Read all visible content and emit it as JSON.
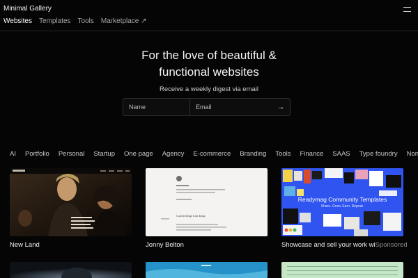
{
  "header": {
    "logo": "Minimal Gallery",
    "nav": [
      "Websites",
      "Templates",
      "Tools",
      "Marketplace ↗"
    ]
  },
  "hero": {
    "title_line1": "For the love of beautiful &",
    "title_line2": "functional websites",
    "subtitle": "Receive a weekly digest via email"
  },
  "form": {
    "name_placeholder": "Name",
    "email_placeholder": "Email",
    "submit": "→"
  },
  "filters": [
    "AI",
    "Portfolio",
    "Personal",
    "Startup",
    "One page",
    "Agency",
    "E-commerce",
    "Branding",
    "Tools",
    "Finance",
    "SAAS",
    "Type foundry",
    "Non"
  ],
  "cards": [
    {
      "title": "New Land"
    },
    {
      "title": "Jonny Belton"
    },
    {
      "title": "Showcase and sell your work wi",
      "badge": "Sponsored"
    }
  ],
  "thumbs": {
    "card2_heading": "Current things I am doing",
    "card3_heading": "Readymag Community Templates",
    "card3_tagline": "Share. Grow. Earn. Repeat."
  },
  "colors": {
    "background": "#050505",
    "readymag_blue": "#2f54f0"
  }
}
